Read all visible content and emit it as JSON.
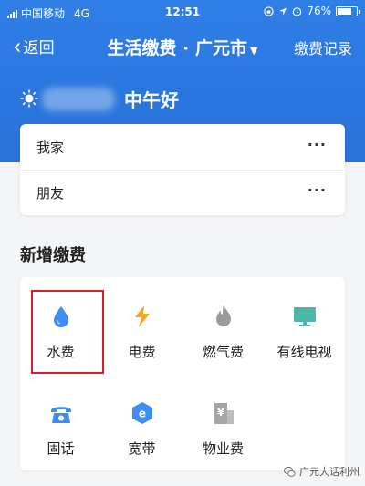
{
  "status": {
    "carrier": "中国移动",
    "network": "4G",
    "time": "12:51",
    "battery": "76%",
    "battery_level": 0.76
  },
  "nav": {
    "back_label": "返回",
    "title": "生活缴费 · 广元市",
    "records_label": "缴费记录"
  },
  "greeting": "中午好",
  "accounts": [
    {
      "name": "我家",
      "more": "···"
    },
    {
      "name": "朋友",
      "more": "···"
    }
  ],
  "new_payment": {
    "title": "新增缴费",
    "items": [
      {
        "label": "水费",
        "icon": "water-drop-icon"
      },
      {
        "label": "电费",
        "icon": "lightning-icon"
      },
      {
        "label": "燃气费",
        "icon": "flame-icon"
      },
      {
        "label": "有线电视",
        "icon": "tv-icon"
      },
      {
        "label": "固话",
        "icon": "telephone-icon"
      },
      {
        "label": "宽带",
        "icon": "broadband-icon"
      },
      {
        "label": "物业费",
        "icon": "building-icon"
      }
    ]
  },
  "watermark": "广元大话利州",
  "colors": {
    "header": "#2f7fe6",
    "water": "#3d8ef0",
    "electric": "#f5a623",
    "gas": "#9b9b9b",
    "tv": "#4cb6a8",
    "phone": "#3d8ef0",
    "broadband": "#3d8ef0",
    "property": "#a6a6a6",
    "highlight": "#d71e27"
  }
}
